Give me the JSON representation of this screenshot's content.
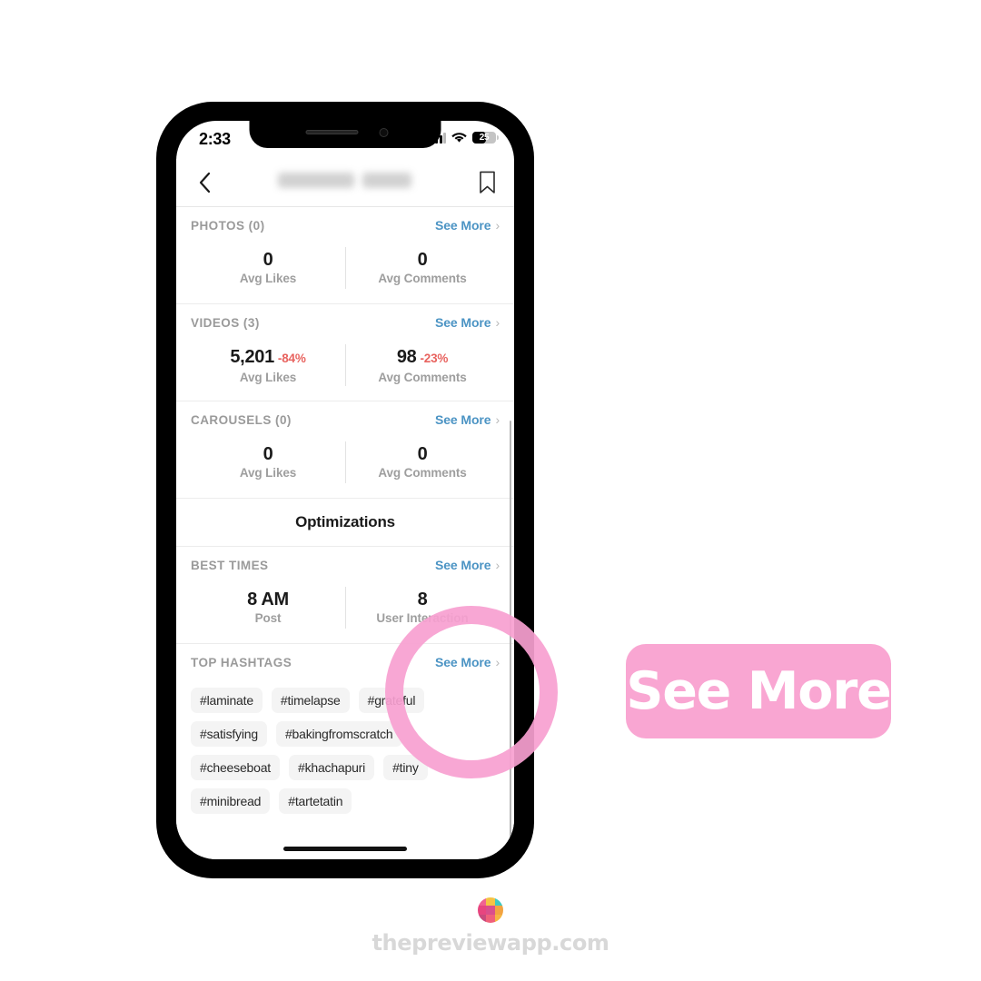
{
  "status_bar": {
    "time": "2:33",
    "battery_level": "25",
    "wifi_icon": "wifi-icon",
    "signal_icon": "cellular-signal-icon"
  },
  "nav": {
    "back_icon": "chevron-left-icon",
    "title": "",
    "title_redacted": true,
    "bookmark_icon": "bookmark-icon"
  },
  "sections": [
    {
      "id": "photos",
      "title": "PHOTOS (0)",
      "see_more": "See More",
      "stats": [
        {
          "value": "0",
          "delta": "",
          "label": "Avg Likes"
        },
        {
          "value": "0",
          "delta": "",
          "label": "Avg Comments"
        }
      ]
    },
    {
      "id": "videos",
      "title": "VIDEOS (3)",
      "see_more": "See More",
      "stats": [
        {
          "value": "5,201",
          "delta": "-84%",
          "label": "Avg Likes"
        },
        {
          "value": "98",
          "delta": "-23%",
          "label": "Avg Comments"
        }
      ]
    },
    {
      "id": "carousels",
      "title": "CAROUSELS (0)",
      "see_more": "See More",
      "stats": [
        {
          "value": "0",
          "delta": "",
          "label": "Avg Likes"
        },
        {
          "value": "0",
          "delta": "",
          "label": "Avg Comments"
        }
      ]
    }
  ],
  "optimizations": {
    "heading": "Optimizations"
  },
  "best_times": {
    "title": "BEST TIMES",
    "see_more": "See More",
    "stats": [
      {
        "value": "8 AM",
        "label": "Post"
      },
      {
        "value": "8",
        "label": "User Interaction"
      }
    ]
  },
  "top_hashtags": {
    "title": "TOP HASHTAGS",
    "see_more": "See More",
    "rows": [
      [
        "#laminate",
        "#timelapse",
        "#grateful"
      ],
      [
        "#satisfying",
        "#bakingfromscratch"
      ],
      [
        "#cheeseboat",
        "#khachapuri",
        "#tiny"
      ],
      [
        "#minibread",
        "#tartetatin"
      ]
    ]
  },
  "annotation": {
    "badge_label": "See More",
    "badge_color": "#f9a6d2",
    "circle_color": "#f79fd0"
  },
  "footer": {
    "text": "thepreviewapp.com",
    "logo_icon": "preview-app-logo-icon",
    "logo_colors": [
      "#f06292",
      "#f5c344",
      "#3fc9c1",
      "#e8457f",
      "#d94f8c",
      "#f2a341",
      "#c94a7d",
      "#f0607a",
      "#f5b642"
    ]
  }
}
